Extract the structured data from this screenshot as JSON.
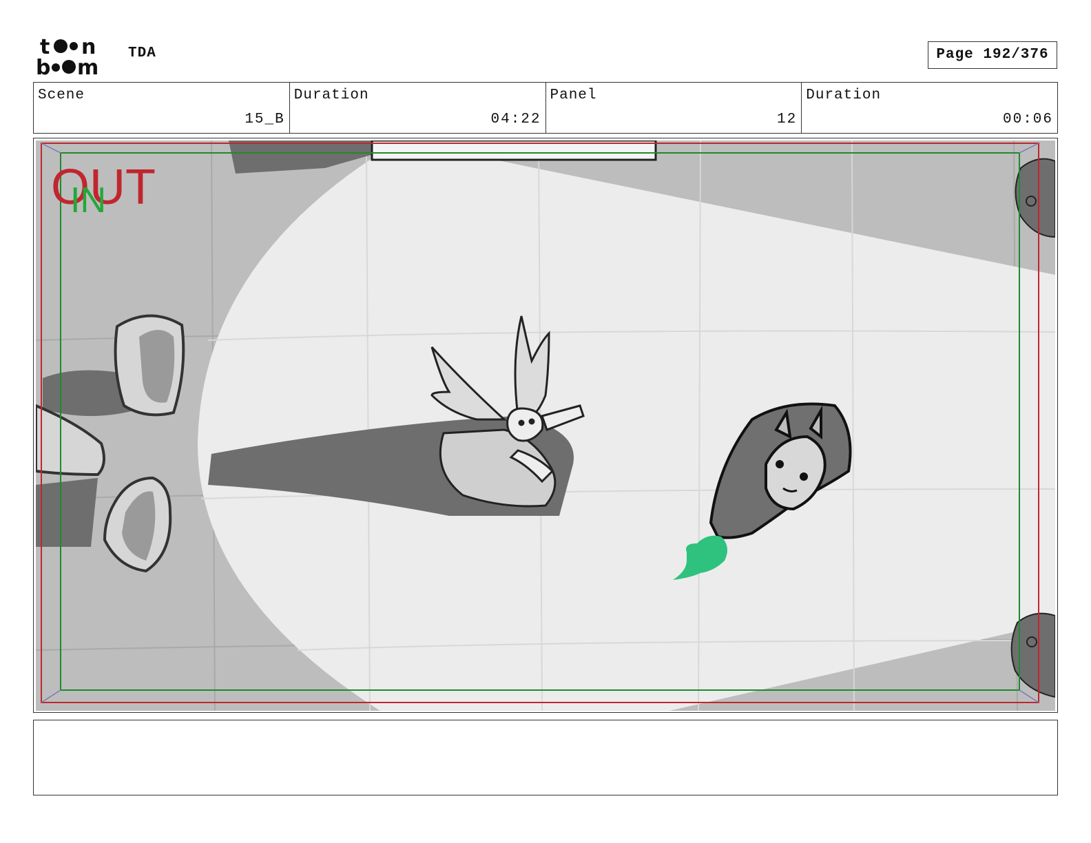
{
  "header": {
    "project": "TDA",
    "page": "Page 192/376"
  },
  "info": {
    "scene_label": "Scene",
    "scene_value": "15_B",
    "scene_duration_label": "Duration",
    "scene_duration_value": "04:22",
    "panel_label": "Panel",
    "panel_value": "12",
    "panel_duration_label": "Duration",
    "panel_duration_value": "00:06"
  },
  "panel": {
    "out_label": "OUT",
    "in_label": "IN",
    "colors": {
      "out_frame": "#c0262e",
      "in_frame": "#1e8a2e",
      "magic": "#2ec27e",
      "floor": "#bdbdbd",
      "spotlight": "#ececec",
      "shadow": "#6e6e6e"
    }
  },
  "notes": {
    "text": ""
  },
  "logo": {
    "text": "toon boom"
  },
  "icons": [
    "toonboom-logo"
  ]
}
